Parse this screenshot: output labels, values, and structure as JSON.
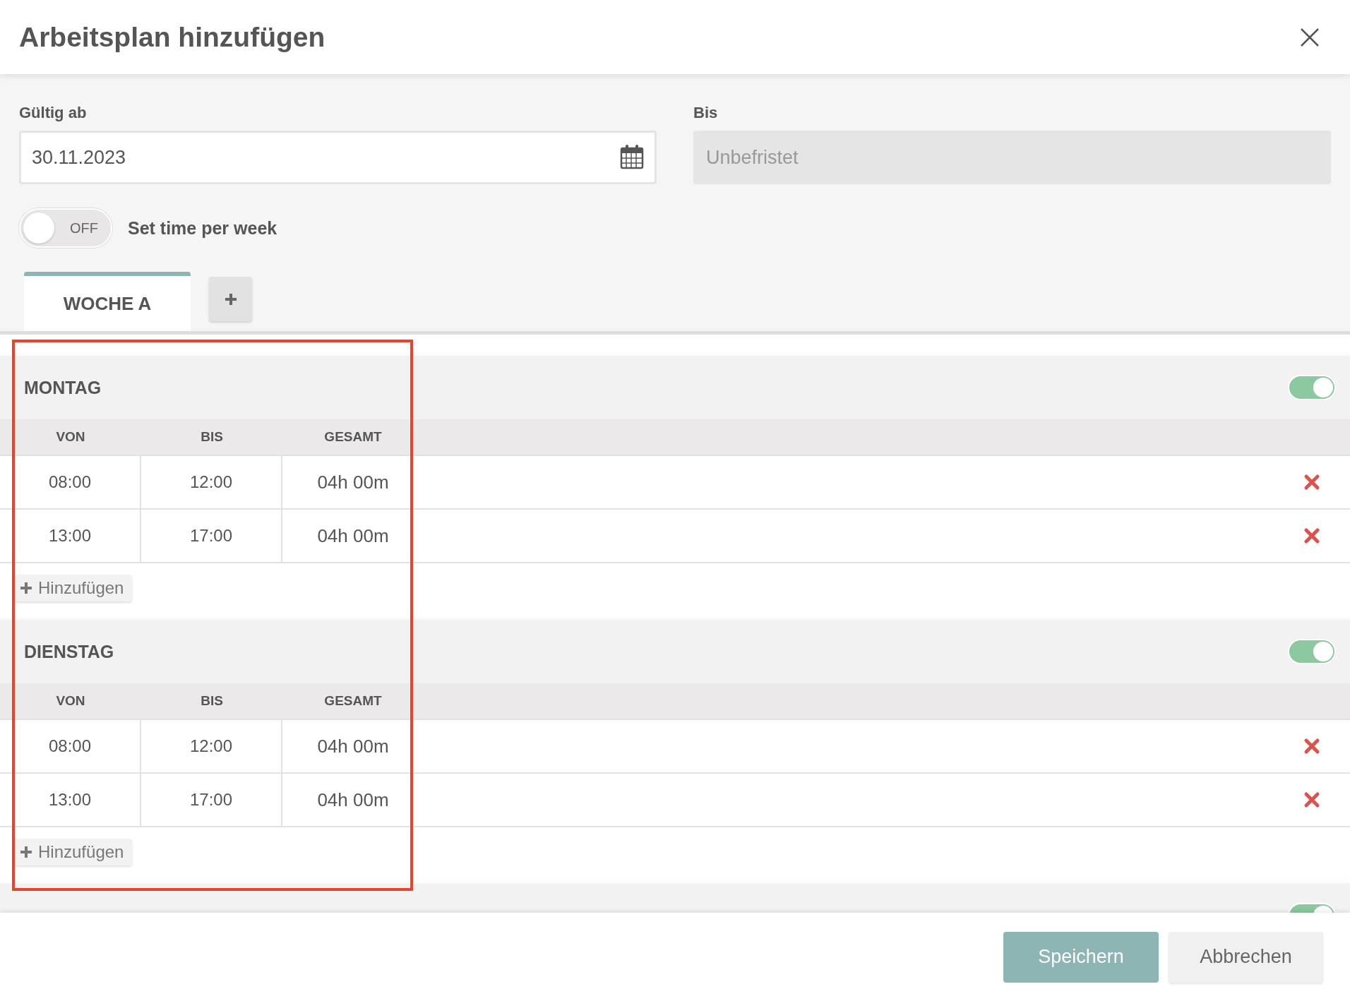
{
  "dialog": {
    "title": "Arbeitsplan hinzufügen"
  },
  "valid_from": {
    "label": "Gültig ab",
    "value": "30.11.2023"
  },
  "valid_to": {
    "label": "Bis",
    "placeholder": "Unbefristet",
    "disabled": true
  },
  "week_toggle": {
    "on": false,
    "state_label": "OFF",
    "label": "Set time per week"
  },
  "tabs": [
    {
      "label": "WOCHE A",
      "selected": true
    }
  ],
  "days": [
    {
      "name": "MONTAG",
      "on": true,
      "columns": [
        "VON",
        "BIS",
        "GESAMT"
      ],
      "rows": [
        [
          "08:00",
          "12:00",
          "04h 00m"
        ],
        [
          "13:00",
          "17:00",
          "04h 00m"
        ]
      ],
      "add_label": "Hinzufügen"
    },
    {
      "name": "DIENSTAG",
      "on": true,
      "columns": [
        "VON",
        "BIS",
        "GESAMT"
      ],
      "rows": [
        [
          "08:00",
          "12:00",
          "04h 00m"
        ],
        [
          "13:00",
          "17:00",
          "04h 00m"
        ]
      ],
      "add_label": "Hinzufügen"
    },
    {
      "on": true
    }
  ],
  "buttons": [
    {
      "label": "Speichern",
      "kind": "primary"
    },
    {
      "label": "Abbrechen",
      "kind": "secondary"
    }
  ]
}
